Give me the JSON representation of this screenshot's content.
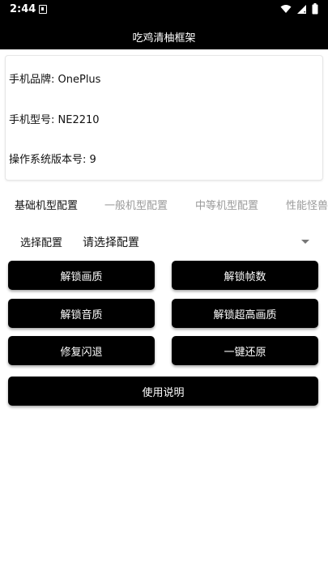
{
  "status_bar": {
    "time": "2:44",
    "icons": [
      "notification-a-icon",
      "wifi-icon",
      "signal-icon",
      "battery-icon"
    ]
  },
  "app_bar": {
    "title": "吃鸡清柚框架"
  },
  "device_info": {
    "brand": "手机品牌: OnePlus",
    "model": "手机型号: NE2210",
    "os_version": "操作系统版本号: 9"
  },
  "tabs": [
    {
      "label": "基础机型配置",
      "active": true
    },
    {
      "label": "一般机型配置",
      "active": false
    },
    {
      "label": "中等机型配置",
      "active": false
    },
    {
      "label": "性能怪兽",
      "active": false
    }
  ],
  "config": {
    "label": "选择配置",
    "selected": "请选择配置"
  },
  "buttons": {
    "unlock_quality": "解锁画质",
    "unlock_fps": "解锁帧数",
    "unlock_audio": "解锁音质",
    "unlock_ultra_hd": "解锁超高画质",
    "fix_crash": "修复闪退",
    "one_click_restore": "一键还原",
    "instructions": "使用说明"
  },
  "colors": {
    "app_bar": "#000000",
    "button": "#000000",
    "tab_inactive": "#9a9a9a"
  }
}
